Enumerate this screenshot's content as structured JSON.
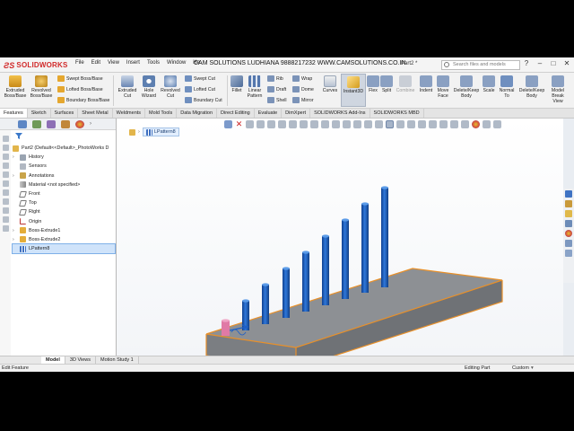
{
  "app": {
    "logo_text": "SOLIDWORKS",
    "banner": "CAM SOLUTIONS LUDHIANA 9888217232  WWW.CAMSOLUTIONS.CO.IN",
    "document": "Part2 *",
    "search_placeholder": "Search files and models"
  },
  "menu": [
    "File",
    "Edit",
    "View",
    "Insert",
    "Tools",
    "Window",
    "He"
  ],
  "ribbon": {
    "extruded_boss": "Extruded Boss/Base",
    "revolved_boss": "Revolved Boss/Base",
    "swept_boss": "Swept Boss/Base",
    "lofted_boss": "Lofted Boss/Base",
    "boundary_boss": "Boundary Boss/Base",
    "extruded_cut": "Extruded Cut",
    "hole_wizard": "Hole Wizard",
    "revolved_cut": "Revolved Cut",
    "swept_cut": "Swept Cut",
    "lofted_cut": "Lofted Cut",
    "boundary_cut": "Boundary Cut",
    "fillet": "Fillet",
    "linear_pattern": "Linear Pattern",
    "rib": "Rib",
    "draft": "Draft",
    "shell": "Shell",
    "wrap": "Wrap",
    "dome": "Dome",
    "mirror": "Mirror",
    "curves": "Curves",
    "instant3d": "Instant3D",
    "flex": "Flex",
    "split": "Split",
    "combine": "Combine",
    "indent": "Indent",
    "move_face": "Move Face",
    "delete_keep_body": "Delete/Keep Body",
    "scale": "Scale",
    "normal_to": "Normal To",
    "delete_keep_body2": "Delete/Keep Body",
    "model_break_view": "Model Break View"
  },
  "command_tabs": [
    "Features",
    "Sketch",
    "Surfaces",
    "Sheet Metal",
    "Weldments",
    "Mold Tools",
    "Data Migration",
    "Direct Editing",
    "Evaluate",
    "DimXpert",
    "SOLIDWORKS Add-Ins",
    "SOLIDWORKS MBD"
  ],
  "tree": {
    "root": "Part2  (Default<<Default>_PhotoWorks D",
    "items": [
      "History",
      "Sensors",
      "Annotations",
      "Material <not specified>",
      "Front",
      "Top",
      "Right",
      "Origin",
      "Boss-Extrude1",
      "Boss-Extrude2",
      "LPattern8"
    ]
  },
  "breadcrumb": [
    "LPattern8"
  ],
  "bottom_tabs": [
    "Model",
    "3D Views",
    "Motion Study 1"
  ],
  "status": {
    "left": "Edit Feature",
    "mode": "Editing Part",
    "units": "Custom"
  },
  "colors": {
    "accent": "#1f5fc2",
    "solidworks_red": "#d12a2a",
    "pin_blue": "#1d5fc7",
    "plate_gray": "#8c8f93",
    "edge_orange": "#e8902a",
    "preview_pink": "#e07aa6"
  }
}
